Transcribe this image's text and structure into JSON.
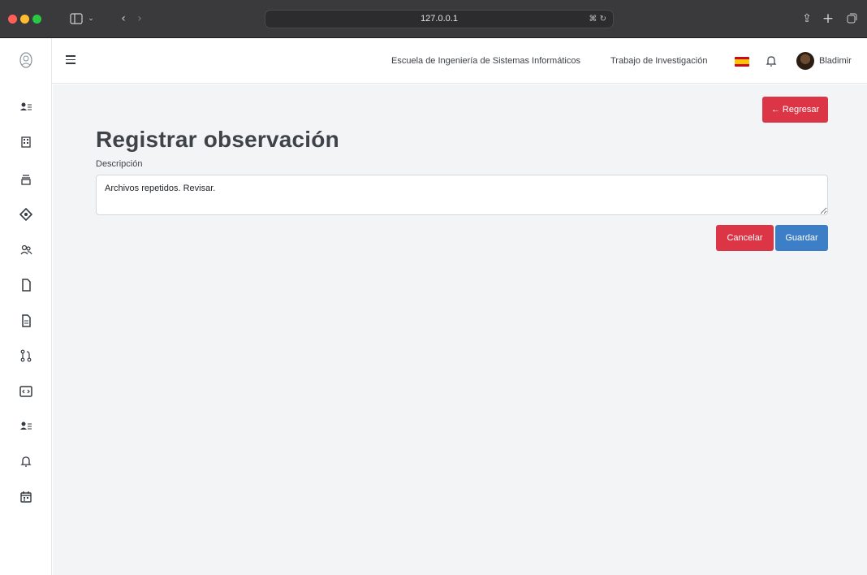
{
  "browser": {
    "url": "127.0.0.1",
    "colors": {
      "close": "#ff5f57",
      "minimize": "#febc2e",
      "maximize": "#28c840"
    },
    "icons": [
      "sidebar-toggle-icon",
      "chevron-down-icon",
      "back-icon",
      "forward-icon",
      "translate-icon",
      "reload-icon",
      "share-icon",
      "new-tab-icon",
      "tabs-overview-icon"
    ]
  },
  "header": {
    "nav": [
      {
        "label": "Escuela de Ingeniería de Sistemas Informáticos"
      },
      {
        "label": "Trabajo de Investigación"
      }
    ],
    "user": {
      "name": "Bladimir"
    },
    "language_flag": "spain-flag-icon"
  },
  "sidebar": {
    "icons": [
      "users-list-icon",
      "building-icon",
      "stack-icon",
      "diamond-icon",
      "people-icon",
      "file-icon",
      "document-icon",
      "git-pull-request-icon",
      "code-window-icon",
      "users-list-icon",
      "bell-icon",
      "calendar-icon"
    ]
  },
  "page": {
    "back_label": "← Regresar",
    "title": "Registrar observación",
    "description_label": "Descripción",
    "description_value": "Archivos repetidos. Revisar.",
    "cancel_label": "Cancelar",
    "save_label": "Guardar",
    "colors": {
      "danger": "#dc3545",
      "primary": "#3d7fc7"
    }
  }
}
